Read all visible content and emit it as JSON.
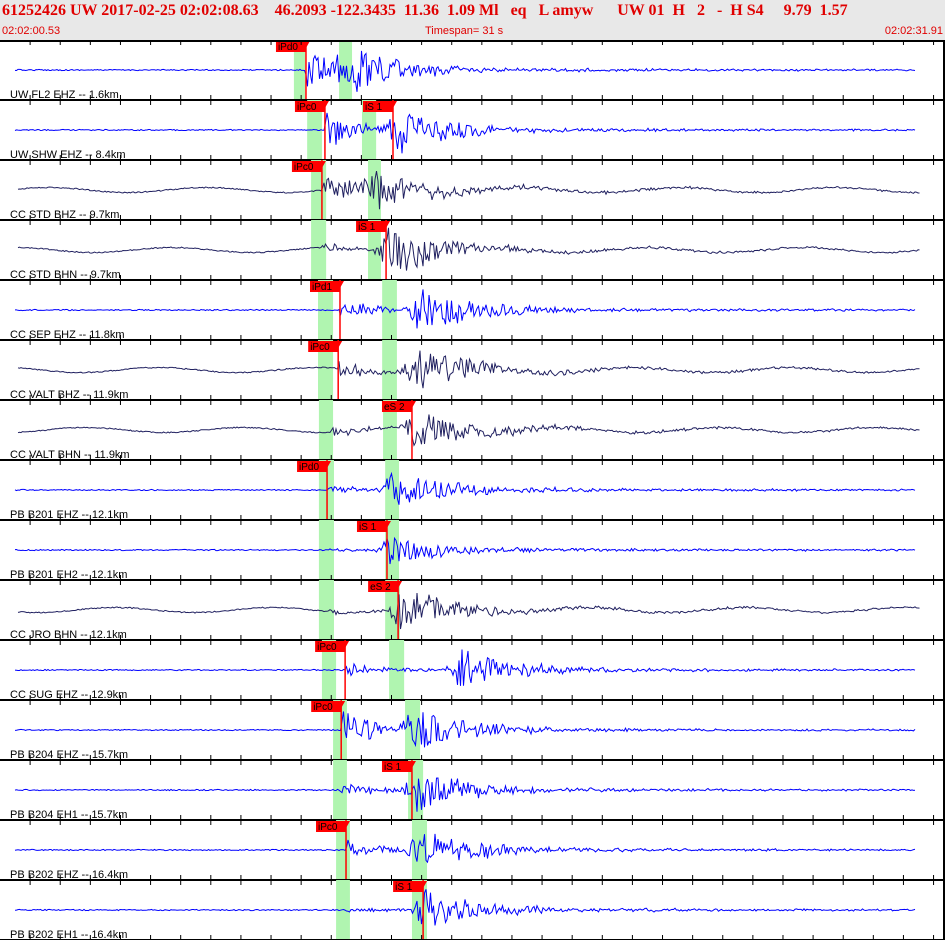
{
  "header": {
    "title": "61252426 UW 2017-02-25 02:02:08.63    46.2093 -122.3435  11.36  1.09 Ml   eq   L amyw      UW 01  H   2   -  H S4     9.79  1.57",
    "start_time": "02:02:00.53",
    "timespan": "Timespan=  31 s",
    "end_time": "02:02:31.91"
  },
  "timespan_seconds": 31.38,
  "colors": {
    "pick": "#ff0000",
    "window": "#b0f5b0",
    "broadband": "#202060",
    "shortperiod": "#0000ff"
  },
  "traces": [
    {
      "label": "UW FL2 EHZ -- 1.6km",
      "color": "shortperiod",
      "p_win": [
        9.76,
        10.13
      ],
      "s_win": [
        11.26,
        11.69
      ],
      "picks": [
        {
          "label": "iPd0",
          "t": 10.16
        }
      ],
      "p": 10.16,
      "s": 11.4,
      "pa": 22,
      "sa": 26
    },
    {
      "label": "UW SHW EHZ -- 8.4km",
      "color": "shortperiod",
      "p_win": [
        10.2,
        10.69
      ],
      "s_win": [
        12.02,
        12.49
      ],
      "picks": [
        {
          "label": "iPc0",
          "t": 10.79
        },
        {
          "label": "iS 1",
          "t": 13.05
        }
      ],
      "p": 10.79,
      "s": 13.05,
      "pa": 20,
      "sa": 26
    },
    {
      "label": "CC STD BHZ -- 9.7km",
      "color": "broadband",
      "p_win": [
        10.33,
        10.83
      ],
      "s_win": [
        12.22,
        12.65
      ],
      "picks": [
        {
          "label": "iPc0",
          "t": 10.69
        }
      ],
      "p": 10.69,
      "s": 12.4,
      "pa": 16,
      "sa": 22
    },
    {
      "label": "CC STD BHN -- 9.7km",
      "color": "broadband",
      "p_win": [
        10.33,
        10.83
      ],
      "s_win": [
        12.22,
        12.65
      ],
      "picks": [
        {
          "label": "iS 1",
          "t": 12.82
        }
      ],
      "p": 10.7,
      "s": 12.82,
      "pa": 4,
      "sa": 26
    },
    {
      "label": "CC SEP EHZ -- 11.8km",
      "color": "shortperiod",
      "p_win": [
        10.56,
        11.06
      ],
      "s_win": [
        12.69,
        13.18
      ],
      "picks": [
        {
          "label": "iPd1",
          "t": 11.29
        }
      ],
      "p": 11.29,
      "s": 13.8,
      "pa": 10,
      "sa": 26
    },
    {
      "label": "CC VALT BHZ -- 11.9km",
      "color": "broadband",
      "p_win": [
        10.56,
        11.06
      ],
      "s_win": [
        12.69,
        13.18
      ],
      "picks": [
        {
          "label": "iPc0",
          "t": 11.23
        }
      ],
      "p": 11.23,
      "s": 13.7,
      "pa": 10,
      "sa": 24
    },
    {
      "label": "CC VALT BHN -- 11.9km",
      "color": "broadband",
      "p_win": [
        10.59,
        11.06
      ],
      "s_win": [
        12.72,
        13.18
      ],
      "picks": [
        {
          "label": "eS 2",
          "t": 13.68
        }
      ],
      "p": 11.0,
      "s": 13.68,
      "pa": 5,
      "sa": 22
    },
    {
      "label": "PB B201 EHZ -- 12.1km",
      "color": "shortperiod",
      "p_win": [
        10.59,
        11.09
      ],
      "s_win": [
        12.79,
        13.25
      ],
      "picks": [
        {
          "label": "iPd0",
          "t": 10.86
        }
      ],
      "p": 10.86,
      "s": 12.95,
      "pa": 4,
      "sa": 20
    },
    {
      "label": "PB B201 EH2 -- 12.1km",
      "color": "shortperiod",
      "p_win": [
        10.59,
        11.09
      ],
      "s_win": [
        12.79,
        13.25
      ],
      "picks": [
        {
          "label": "iS 1",
          "t": 12.85
        }
      ],
      "p": 10.86,
      "s": 12.9,
      "pa": 2,
      "sa": 16
    },
    {
      "label": "CC JRO BHN -- 12.1km",
      "color": "broadband",
      "p_win": [
        10.59,
        11.09
      ],
      "s_win": [
        12.79,
        13.28
      ],
      "picks": [
        {
          "label": "eS 2",
          "t": 13.22
        }
      ],
      "p": 10.9,
      "s": 13.22,
      "pa": 3,
      "sa": 24
    },
    {
      "label": "CC SUG EHZ -- 12.9km",
      "color": "shortperiod",
      "p_win": [
        10.69,
        11.16
      ],
      "s_win": [
        12.92,
        13.42
      ],
      "picks": [
        {
          "label": "iPc0",
          "t": 11.46
        }
      ],
      "p": 11.46,
      "s": 15.2,
      "pa": 6,
      "sa": 22
    },
    {
      "label": "PB B204 EHZ -- 15.7km",
      "color": "shortperiod",
      "p_win": [
        11.06,
        11.52
      ],
      "s_win": [
        13.45,
        13.95
      ],
      "picks": [
        {
          "label": "iPc0",
          "t": 11.33
        }
      ],
      "p": 11.33,
      "s": 13.6,
      "pa": 22,
      "sa": 24
    },
    {
      "label": "PB B204 EH1 -- 15.7km",
      "color": "shortperiod",
      "p_win": [
        11.06,
        11.52
      ],
      "s_win": [
        13.55,
        14.05
      ],
      "picks": [
        {
          "label": "iS 1",
          "t": 13.68
        }
      ],
      "p": 11.3,
      "s": 13.68,
      "pa": 8,
      "sa": 24
    },
    {
      "label": "PB B202 EHZ -- 16.4km",
      "color": "shortperiod",
      "p_win": [
        11.16,
        11.62
      ],
      "s_win": [
        13.68,
        14.18
      ],
      "picks": [
        {
          "label": "iPc0",
          "t": 11.49
        }
      ],
      "p": 11.49,
      "s": 13.8,
      "pa": 10,
      "sa": 24
    },
    {
      "label": "PB B202 EH1 -- 16.4km",
      "color": "shortperiod",
      "p_win": [
        11.16,
        11.62
      ],
      "s_win": [
        13.68,
        14.18
      ],
      "picks": [
        {
          "label": "iS 1",
          "t": 14.05
        }
      ],
      "p": 11.5,
      "s": 14.05,
      "pa": 3,
      "sa": 22
    }
  ]
}
